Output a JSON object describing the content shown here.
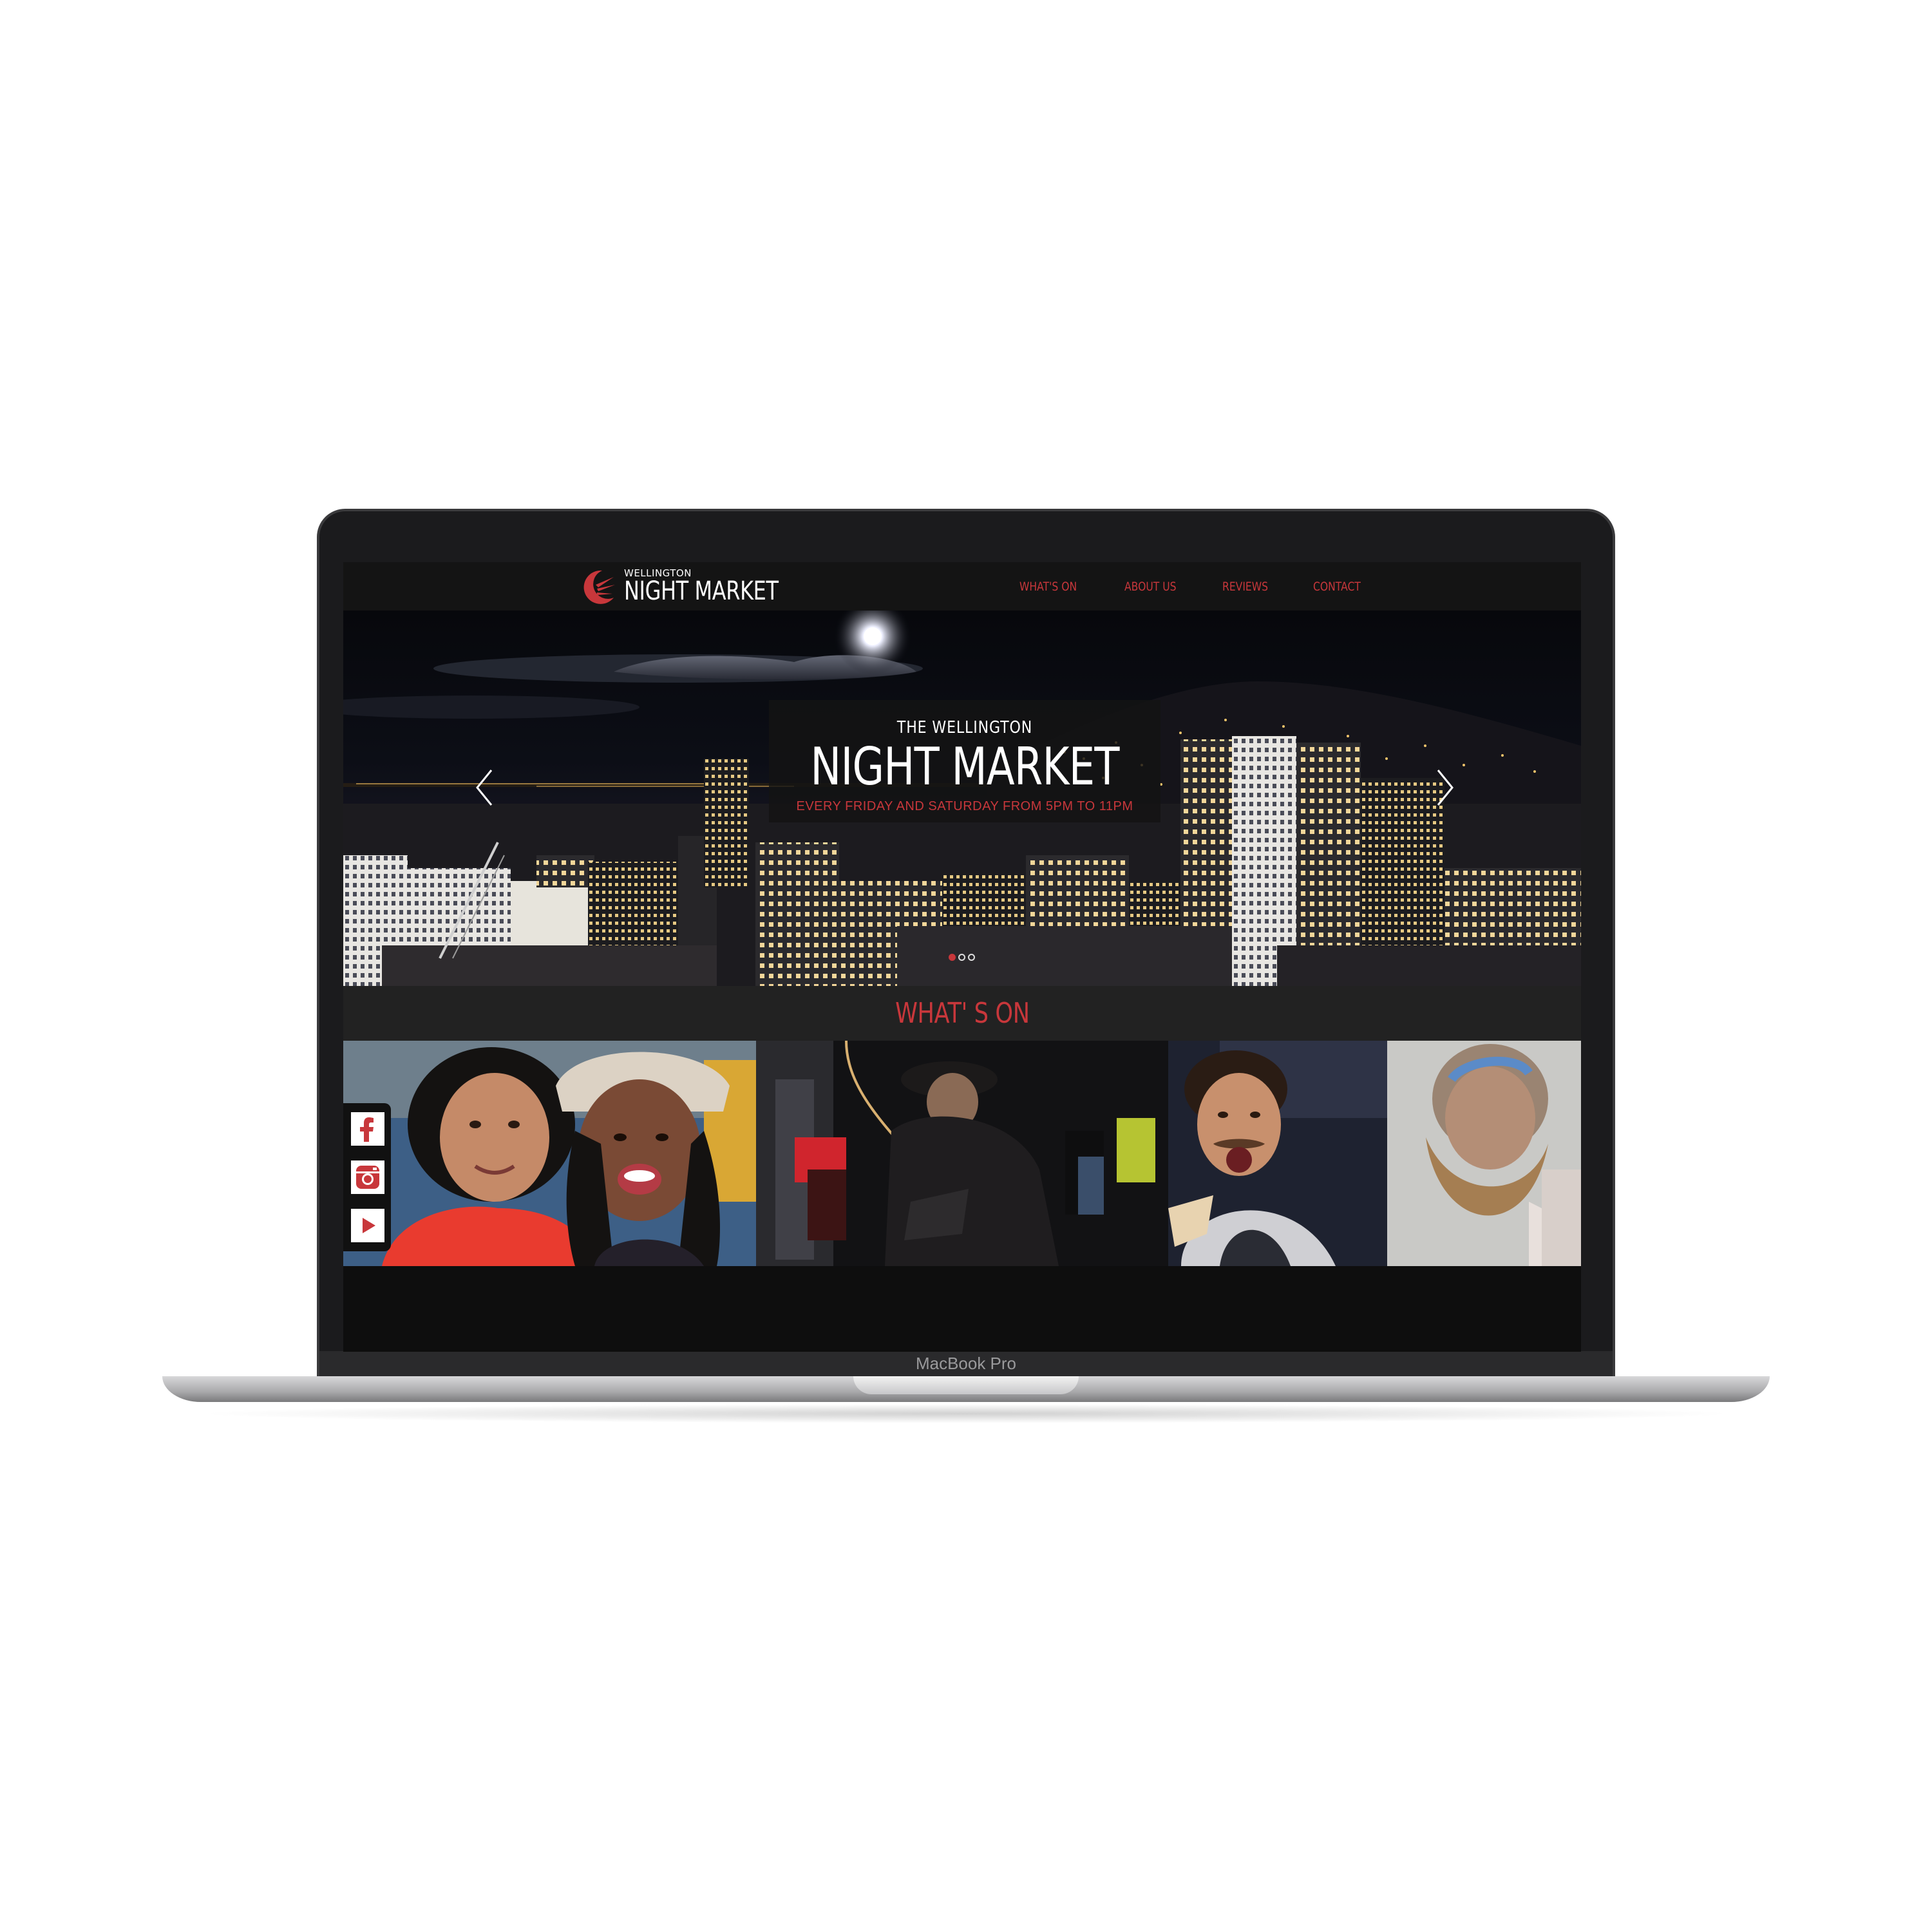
{
  "device": {
    "label": "MacBook Pro"
  },
  "site": {
    "logo": {
      "small": "WELLINGTON",
      "big": "NIGHT MARKET"
    },
    "nav": [
      {
        "label": "WHAT'S ON"
      },
      {
        "label": "ABOUT US"
      },
      {
        "label": "REVIEWS"
      },
      {
        "label": "CONTACT"
      }
    ],
    "hero": {
      "pre_title": "THE WELLINGTON",
      "title": "NIGHT MARKET",
      "subtitle": "EVERY FRIDAY AND SATURDAY FROM 5PM TO 11PM",
      "slides_total": 3,
      "active_slide": 1
    },
    "section_title": "WHAT' S ON",
    "social": [
      {
        "icon": "facebook-icon"
      },
      {
        "icon": "instagram-icon"
      },
      {
        "icon": "youtube-icon"
      }
    ]
  },
  "colors": {
    "accent": "#c8373b",
    "header_bg": "#141414",
    "section_bg": "#222222",
    "screen_bg": "#0f0f0f"
  }
}
